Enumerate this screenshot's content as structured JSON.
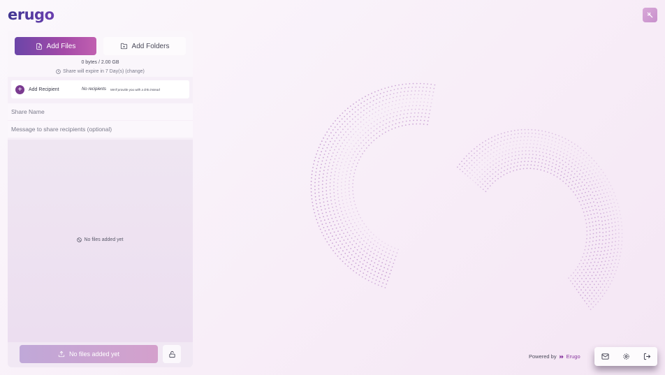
{
  "app": {
    "logo": "erugo"
  },
  "upload_panel": {
    "add_files_label": "Add Files",
    "add_folders_label": "Add Folders",
    "size_usage": "0 bytes / 2.00 GB",
    "expiry_notice": "Share will expire in 7 Day(s) (change)",
    "recipients": {
      "add_label": "Add Recipient",
      "status": "No recipients",
      "hint": "We'll provide you with a link instead"
    },
    "share_name_placeholder": "Share Name",
    "message_placeholder": "Message to share recipients (optional)",
    "empty_text": "No files added yet",
    "upload_button_label": "No files added yet"
  },
  "footer": {
    "powered_by": "Powered by",
    "brand": "Erugo"
  },
  "icons": {
    "avatar": "sparkle-icon",
    "add_files": "file-plus-icon",
    "add_folders": "folder-plus-icon",
    "expiry": "clock-icon",
    "add_recipient": "plus-icon",
    "empty": "ban-icon",
    "upload": "upload-icon",
    "lock": "lock-open-icon",
    "dock": [
      "mail-icon",
      "settings-icon",
      "logout-icon"
    ]
  },
  "colors": {
    "accent": "#7a3a90",
    "brand_gradient_start": "#6b45a8",
    "brand_gradient_end": "#c160b0"
  }
}
